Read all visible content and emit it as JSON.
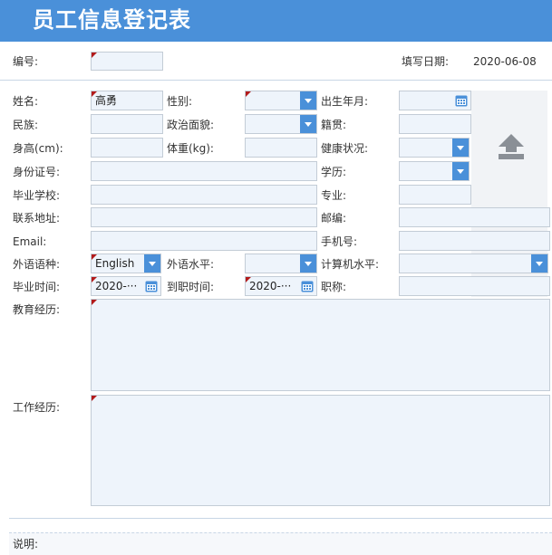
{
  "header": {
    "title": "员工信息登记表"
  },
  "meta": {
    "number_label": "编号:",
    "number_value": "",
    "fill_date_label": "填写日期:",
    "fill_date_value": "2020-06-08"
  },
  "fields": {
    "name": {
      "label": "姓名:",
      "value": "高勇"
    },
    "gender": {
      "label": "性别:",
      "value": ""
    },
    "birth": {
      "label": "出生年月:",
      "value": ""
    },
    "ethnicity": {
      "label": "民族:",
      "value": ""
    },
    "political": {
      "label": "政治面貌:",
      "value": ""
    },
    "native_place": {
      "label": "籍贯:",
      "value": ""
    },
    "height": {
      "label": "身高(cm):",
      "value": ""
    },
    "weight": {
      "label": "体重(kg):",
      "value": ""
    },
    "health": {
      "label": "健康状况:",
      "value": ""
    },
    "id_number": {
      "label": "身份证号:",
      "value": ""
    },
    "education": {
      "label": "学历:",
      "value": ""
    },
    "school": {
      "label": "毕业学校:",
      "value": ""
    },
    "major": {
      "label": "专业:",
      "value": ""
    },
    "address": {
      "label": "联系地址:",
      "value": ""
    },
    "postcode": {
      "label": "邮编:",
      "value": ""
    },
    "email": {
      "label": "Email:",
      "value": ""
    },
    "phone": {
      "label": "手机号:",
      "value": ""
    },
    "foreign_lang": {
      "label": "外语语种:",
      "value": "English"
    },
    "foreign_level": {
      "label": "外语水平:",
      "value": ""
    },
    "computer_level": {
      "label": "计算机水平:",
      "value": ""
    },
    "grad_time": {
      "label": "毕业时间:",
      "value": "2020-···"
    },
    "join_time": {
      "label": "到职时间:",
      "value": "2020-···"
    },
    "title": {
      "label": "职称:",
      "value": ""
    },
    "edu_history": {
      "label": "教育经历:",
      "value": ""
    },
    "work_history": {
      "label": "工作经历:",
      "value": ""
    }
  },
  "footer": {
    "note_label": "说明:"
  },
  "colors": {
    "header_bg": "#4a90d9",
    "field_bg": "#eef4fb",
    "field_border": "#c3ccd6",
    "required_marker": "#b31b1b",
    "button_accent": "#4a90d9",
    "upload_icon": "#8a8f96"
  },
  "icons": {
    "dropdown": "triangle-down",
    "date": "calendar",
    "upload": "upload-arrow"
  }
}
